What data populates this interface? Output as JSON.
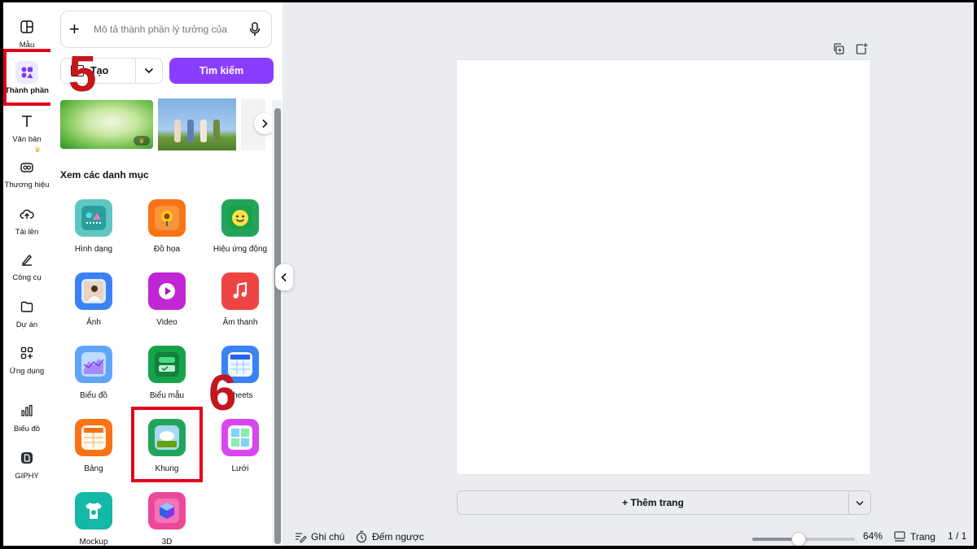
{
  "rail": {
    "items": [
      {
        "label": "Mẫu",
        "icon": "layout-icon"
      },
      {
        "label": "Thành phần",
        "icon": "elements-icon"
      },
      {
        "label": "Văn bản",
        "icon": "text-icon"
      },
      {
        "label": "Thương hiệu",
        "icon": "brand-icon"
      },
      {
        "label": "Tải lên",
        "icon": "upload-cloud-icon"
      },
      {
        "label": "Công cụ",
        "icon": "pen-tool-icon"
      },
      {
        "label": "Dự án",
        "icon": "folder-icon"
      },
      {
        "label": "Ứng dụng",
        "icon": "apps-icon"
      },
      {
        "label": "Biểu đồ",
        "icon": "bar-chart-icon"
      },
      {
        "label": "GIPHY",
        "icon": "giphy-icon"
      }
    ]
  },
  "panel": {
    "search_placeholder": "Mô tả thành phần lý tưởng của",
    "create_label": "Tạo",
    "search_button": "Tìm kiếm",
    "section_title": "Xem các danh mục",
    "categories": [
      {
        "label": "Hình dạng",
        "color": "#5fc7c3"
      },
      {
        "label": "Đồ họa",
        "color": "#f97316"
      },
      {
        "label": "Hiệu ứng động",
        "color": "#22a55b"
      },
      {
        "label": "Ảnh",
        "color": "#3b82f6"
      },
      {
        "label": "Video",
        "color": "#c026d3"
      },
      {
        "label": "Âm thanh",
        "color": "#ef4444"
      },
      {
        "label": "Biểu đồ",
        "color": "#60a5fa"
      },
      {
        "label": "Biểu mẫu",
        "color": "#16a34a"
      },
      {
        "label": "Sheets",
        "color": "#3b82f6"
      },
      {
        "label": "Bảng",
        "color": "#f97316"
      },
      {
        "label": "Khung",
        "color": "#22a55b"
      },
      {
        "label": "Lưới",
        "color": "#d946ef"
      },
      {
        "label": "Mockup",
        "color": "#14b8a6"
      },
      {
        "label": "3D",
        "color": "#ec4899"
      }
    ]
  },
  "annotations": {
    "step_a": "5",
    "step_b": "6"
  },
  "canvas": {
    "add_page": "+ Thêm trang"
  },
  "footer": {
    "notes": "Ghi chú",
    "timer": "Đếm ngược",
    "zoom": "64%",
    "zoom_fraction": 0.45,
    "pages": "Trang",
    "page_count": "1 / 1"
  },
  "colors": {
    "accent": "#8b3dff",
    "highlight": "#e3001b"
  }
}
